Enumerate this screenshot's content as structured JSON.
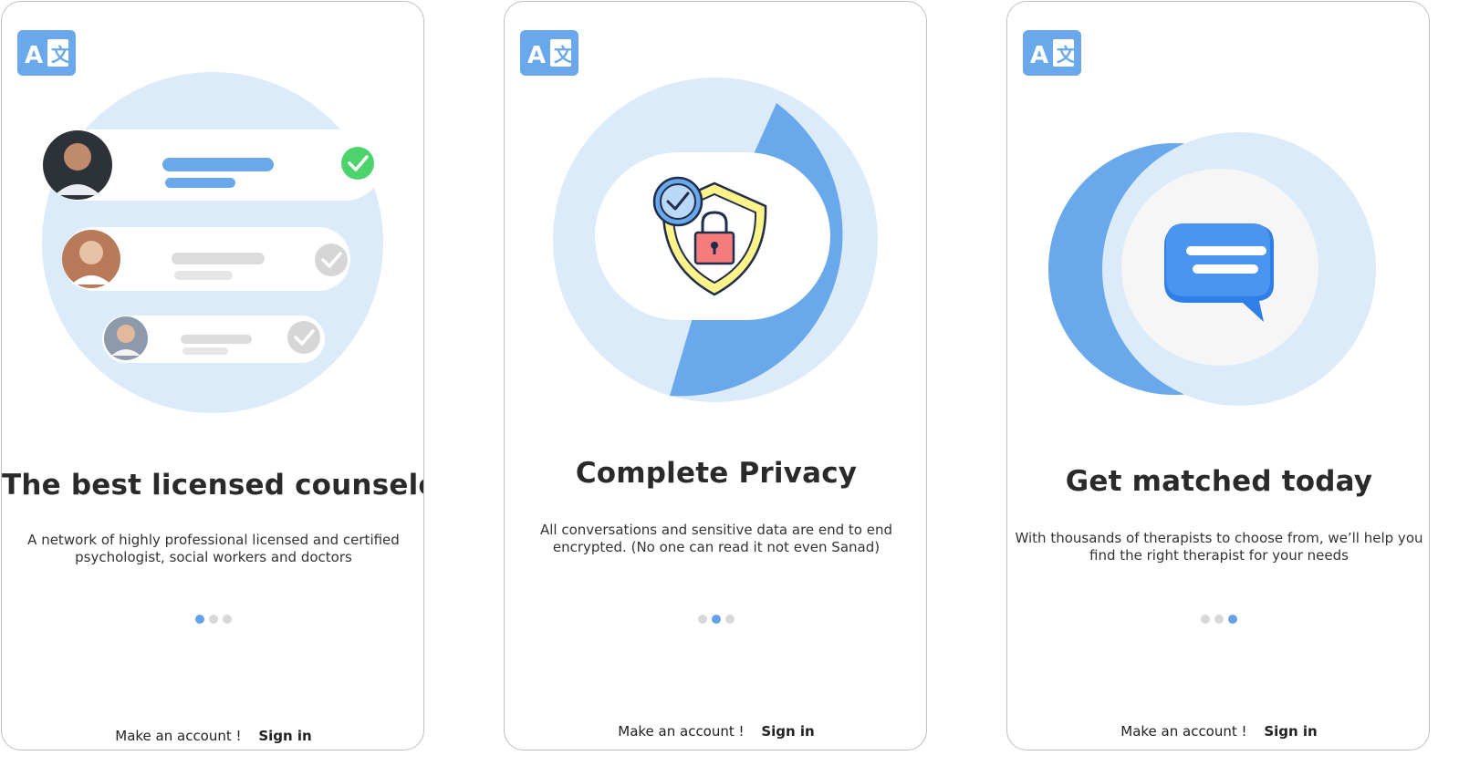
{
  "screens": [
    {
      "title": "The best licensed counselors",
      "description": "A network of highly professional licensed and certified psychologist, social workers and doctors",
      "footer": {
        "make_account": "Make an account !",
        "sign_in": "Sign in"
      },
      "active_dot": 1
    },
    {
      "title": "Complete Privacy",
      "description": "All conversations and sensitive data are end to end encrypted. (No one can read it not even Sanad)",
      "footer": {
        "make_account": "Make an account !",
        "sign_in": "Sign in"
      },
      "active_dot": 2
    },
    {
      "title": "Get matched today",
      "description": "With thousands of therapists to choose from, we’ll help you find the right therapist for your needs",
      "footer": {
        "make_account": "Make an account !",
        "sign_in": "Sign in"
      },
      "active_dot": 3
    }
  ],
  "icons": {
    "language": "translate-icon",
    "verified": "check-circle-icon",
    "privacy": "shield-lock-icon",
    "chat": "chat-bubble-icon"
  },
  "colors": {
    "accent": "#64a2e6",
    "accent_light": "#dcebfa",
    "check_green": "#4cd36b",
    "inactive_gray": "#d8d8d8"
  }
}
